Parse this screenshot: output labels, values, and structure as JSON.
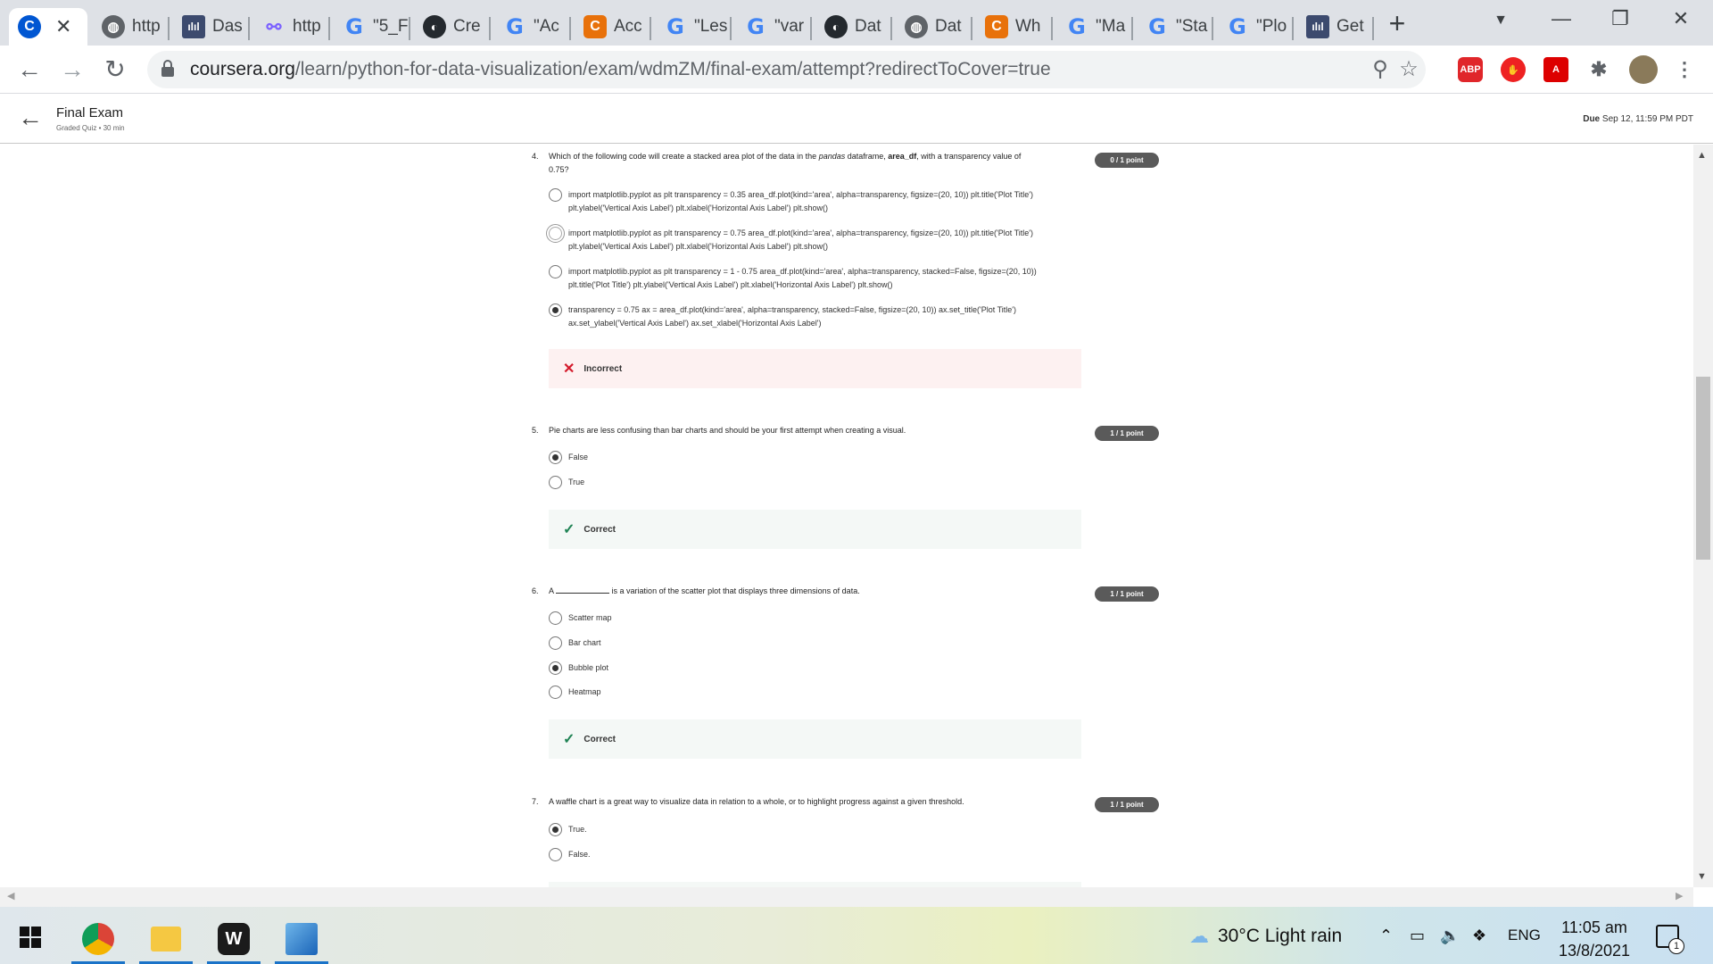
{
  "browser": {
    "tabs": [
      {
        "label": "",
        "favicon": "coursera-icon",
        "active": true
      },
      {
        "label": "http",
        "favicon": "globe-icon"
      },
      {
        "label": "Das",
        "favicon": "dashboard-icon"
      },
      {
        "label": "http",
        "favicon": "link-icon"
      },
      {
        "label": "\"5_F",
        "favicon": "google-icon"
      },
      {
        "label": "Cre",
        "favicon": "github-icon"
      },
      {
        "label": "\"Ac",
        "favicon": "google-icon"
      },
      {
        "label": "Acc",
        "favicon": "coursera-icon"
      },
      {
        "label": "\"Les",
        "favicon": "google-icon"
      },
      {
        "label": "\"var",
        "favicon": "google-icon"
      },
      {
        "label": "Dat",
        "favicon": "github-icon"
      },
      {
        "label": "Dat",
        "favicon": "globe-icon"
      },
      {
        "label": "Wh",
        "favicon": "coursera-icon"
      },
      {
        "label": "\"Ma",
        "favicon": "google-icon"
      },
      {
        "label": "\"Sta",
        "favicon": "google-icon"
      },
      {
        "label": "\"Plo",
        "favicon": "google-icon"
      },
      {
        "label": "Get",
        "favicon": "dashboard-icon"
      }
    ],
    "url_host": "coursera.org",
    "url_path": "/learn/python-for-data-visualization/exam/wdmZM/final-exam/attempt?redirectToCover=true",
    "extensions": [
      "ABP"
    ]
  },
  "header": {
    "title": "Final Exam",
    "subtitle": "Graded Quiz • 30 min",
    "due_label": "Due",
    "due_date": "Sep 12, 11:59 PM PDT"
  },
  "questions": [
    {
      "number": "4.",
      "text_pre": "Which of the following code will create a stacked area plot of the data in the ",
      "text_em": "pandas",
      "text_mid": " dataframe, ",
      "text_strong": "area_df",
      "text_post": ", with a transparency value of 0.75?",
      "points": "0 / 1 point",
      "options": [
        "import matplotlib.pyplot as plt transparency = 0.35 area_df.plot(kind='area', alpha=transparency, figsize=(20, 10)) plt.title('Plot Title') plt.ylabel('Vertical Axis Label') plt.xlabel('Horizontal Axis Label') plt.show()",
        "import matplotlib.pyplot as plt transparency = 0.75 area_df.plot(kind='area', alpha=transparency, figsize=(20, 10)) plt.title('Plot Title') plt.ylabel('Vertical Axis Label') plt.xlabel('Horizontal Axis Label') plt.show()",
        "import matplotlib.pyplot as plt transparency = 1 - 0.75 area_df.plot(kind='area', alpha=transparency, stacked=False, figsize=(20, 10)) plt.title('Plot Title') plt.ylabel('Vertical Axis Label') plt.xlabel('Horizontal Axis Label') plt.show()",
        "transparency = 0.75 ax = area_df.plot(kind='area', alpha=transparency, stacked=False, figsize=(20, 10)) ax.set_title('Plot Title') ax.set_ylabel('Vertical Axis Label') ax.set_xlabel('Horizontal Axis Label')"
      ],
      "selected": 3,
      "feedback": "Incorrect"
    },
    {
      "number": "5.",
      "text": "Pie charts are less confusing than bar charts and should be your first attempt when creating a visual.",
      "points": "1 / 1 point",
      "options": [
        "False",
        "True"
      ],
      "selected": 0,
      "feedback": "Correct"
    },
    {
      "number": "6.",
      "text_pre": "A",
      "text_post": "is a variation of the scatter plot that displays three dimensions of data.",
      "points": "1 / 1 point",
      "options": [
        "Scatter map",
        "Bar chart",
        "Bubble plot",
        "Heatmap"
      ],
      "selected": 2,
      "feedback": "Correct"
    },
    {
      "number": "7.",
      "text": "A waffle chart is a great way to visualize data in relation to a whole, or to highlight progress against a given threshold.",
      "points": "1 / 1 point",
      "options": [
        "True.",
        "False."
      ],
      "selected": 0
    }
  ],
  "taskbar": {
    "weather": "30°C  Light rain",
    "language": "ENG",
    "time": "11:05 am",
    "date": "13/8/2021",
    "notifications": "1"
  },
  "colors": {
    "incorrect": "#d41b2c",
    "correct": "#1f8354",
    "points_badge": "#5a5a5a"
  }
}
